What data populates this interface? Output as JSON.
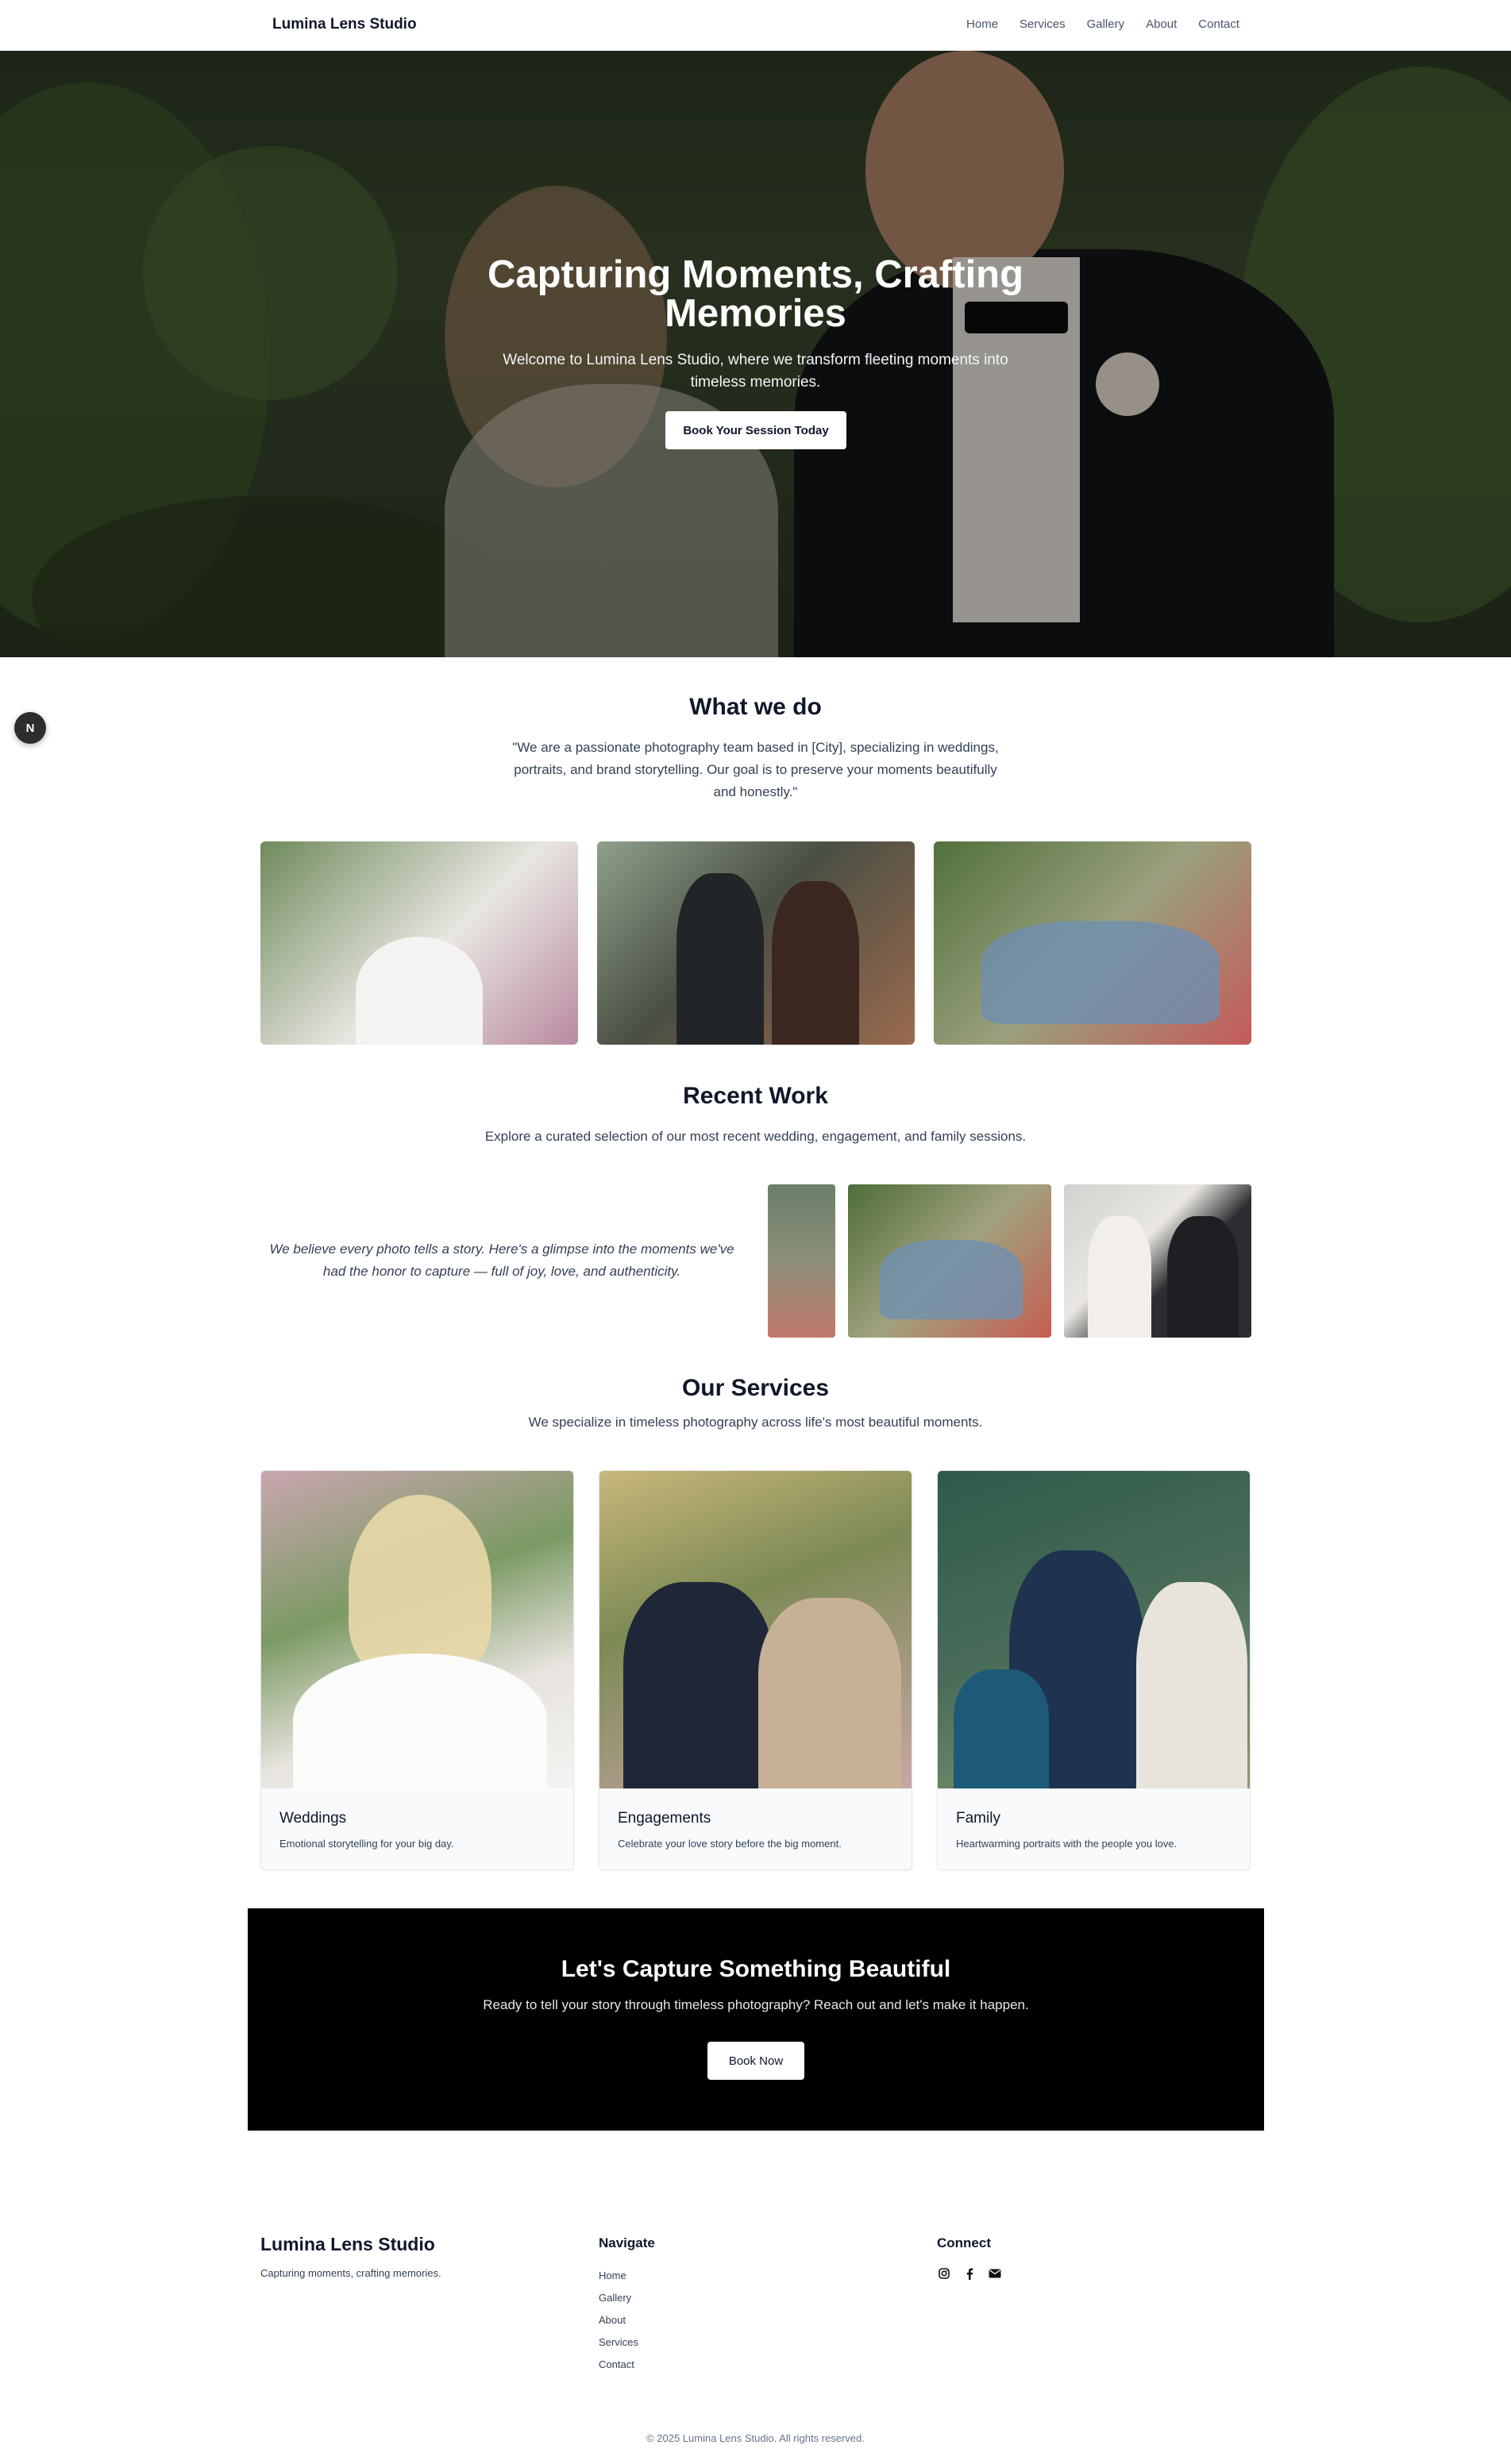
{
  "nav": {
    "brand": "Lumina Lens Studio",
    "links": [
      "Home",
      "Services",
      "Gallery",
      "About",
      "Contact"
    ]
  },
  "hero": {
    "title_line1": "Capturing Moments, Crafting",
    "title_line2": "Memories",
    "subtitle_line1": "Welcome to Lumina Lens Studio, where we transform fleeting moments into",
    "subtitle_line2": "timeless memories.",
    "button": "Book Your Session Today"
  },
  "floating_badge": "N",
  "what_we_do": {
    "title": "What we do",
    "text_line1": "\"We are a passionate photography team based in [City], specializing in weddings,",
    "text_line2": "portraits, and brand storytelling. Our goal is to preserve your moments beautifully",
    "text_line3": "and honestly.\""
  },
  "recent_work": {
    "title": "Recent Work",
    "subtitle": "Explore a curated selection of our most recent wedding, engagement, and family sessions.",
    "quote_line1": "We believe every photo tells a story. Here's a glimpse into the moments we've",
    "quote_line2": "had the honor to capture — full of joy, love, and authenticity."
  },
  "services": {
    "title": "Our Services",
    "subtitle": "We specialize in timeless photography across life's most beautiful moments.",
    "cards": [
      {
        "title": "Weddings",
        "desc": "Emotional storytelling for your big day."
      },
      {
        "title": "Engagements",
        "desc": "Celebrate your love story before the big moment."
      },
      {
        "title": "Family",
        "desc": "Heartwarming portraits with the people you love."
      }
    ]
  },
  "cta": {
    "title": "Let's Capture Something Beautiful",
    "text": "Ready to tell your story through timeless photography? Reach out and let's make it happen.",
    "button": "Book Now"
  },
  "footer": {
    "brand": "Lumina Lens Studio",
    "tagline": "Capturing moments, crafting memories.",
    "navigate_heading": "Navigate",
    "navigate_links": [
      "Home",
      "Gallery",
      "About",
      "Services",
      "Contact"
    ],
    "connect_heading": "Connect",
    "icons": [
      "instagram-icon",
      "facebook-icon",
      "email-icon"
    ],
    "copyright": "© 2025 Lumina Lens Studio. All rights reserved."
  }
}
